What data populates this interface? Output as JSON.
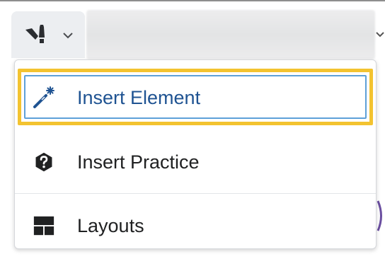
{
  "colors": {
    "accent_text": "#1f5392",
    "focus_ring": "#f3c330",
    "inner_ring": "#5ea0d8",
    "toolbar_bg": "#eceef1",
    "text": "#202122"
  },
  "toolbar": {
    "insert_button_icon": "pen-tools-icon",
    "dropdown_icon": "chevron-down-icon"
  },
  "menu": {
    "items": [
      {
        "label": "Insert Element",
        "icon": "magic-wand-icon",
        "focused": true
      },
      {
        "label": "Insert Practice",
        "icon": "question-circle-icon",
        "focused": false
      },
      {
        "label": "Layouts",
        "icon": "layout-grid-icon",
        "focused": false
      }
    ]
  }
}
